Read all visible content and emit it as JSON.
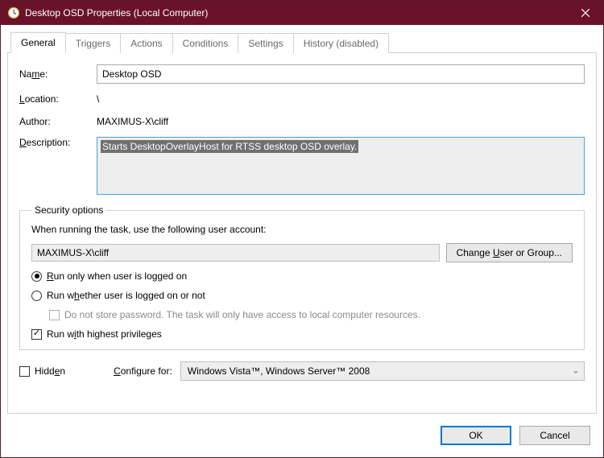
{
  "window": {
    "title": "Desktop OSD Properties (Local Computer)"
  },
  "tabs": {
    "general": "General",
    "triggers": "Triggers",
    "actions": "Actions",
    "conditions": "Conditions",
    "settings": "Settings",
    "history": "History (disabled)"
  },
  "general": {
    "name_label": "Name:",
    "name_value": "Desktop OSD",
    "location_label": "Location:",
    "location_value": "\\",
    "author_label": "Author:",
    "author_value": "MAXIMUS-X\\cliff",
    "description_label": "Description:",
    "description_value": "Starts DesktopOverlayHost for RTSS desktop OSD overlay."
  },
  "security": {
    "legend": "Security options",
    "prompt": "When running the task, use the following user account:",
    "account": "MAXIMUS-X\\cliff",
    "change_btn": "Change User or Group...",
    "radio_logged_on": "Run only when user is logged on",
    "radio_whether": "Run whether user is logged on or not",
    "dont_store": "Do not store password.  The task will only have access to local computer resources.",
    "highest": "Run with highest privileges"
  },
  "bottom": {
    "hidden_label": "Hidden",
    "configure_label": "Configure for:",
    "configure_value": "Windows Vista™, Windows Server™ 2008"
  },
  "footer": {
    "ok": "OK",
    "cancel": "Cancel"
  }
}
